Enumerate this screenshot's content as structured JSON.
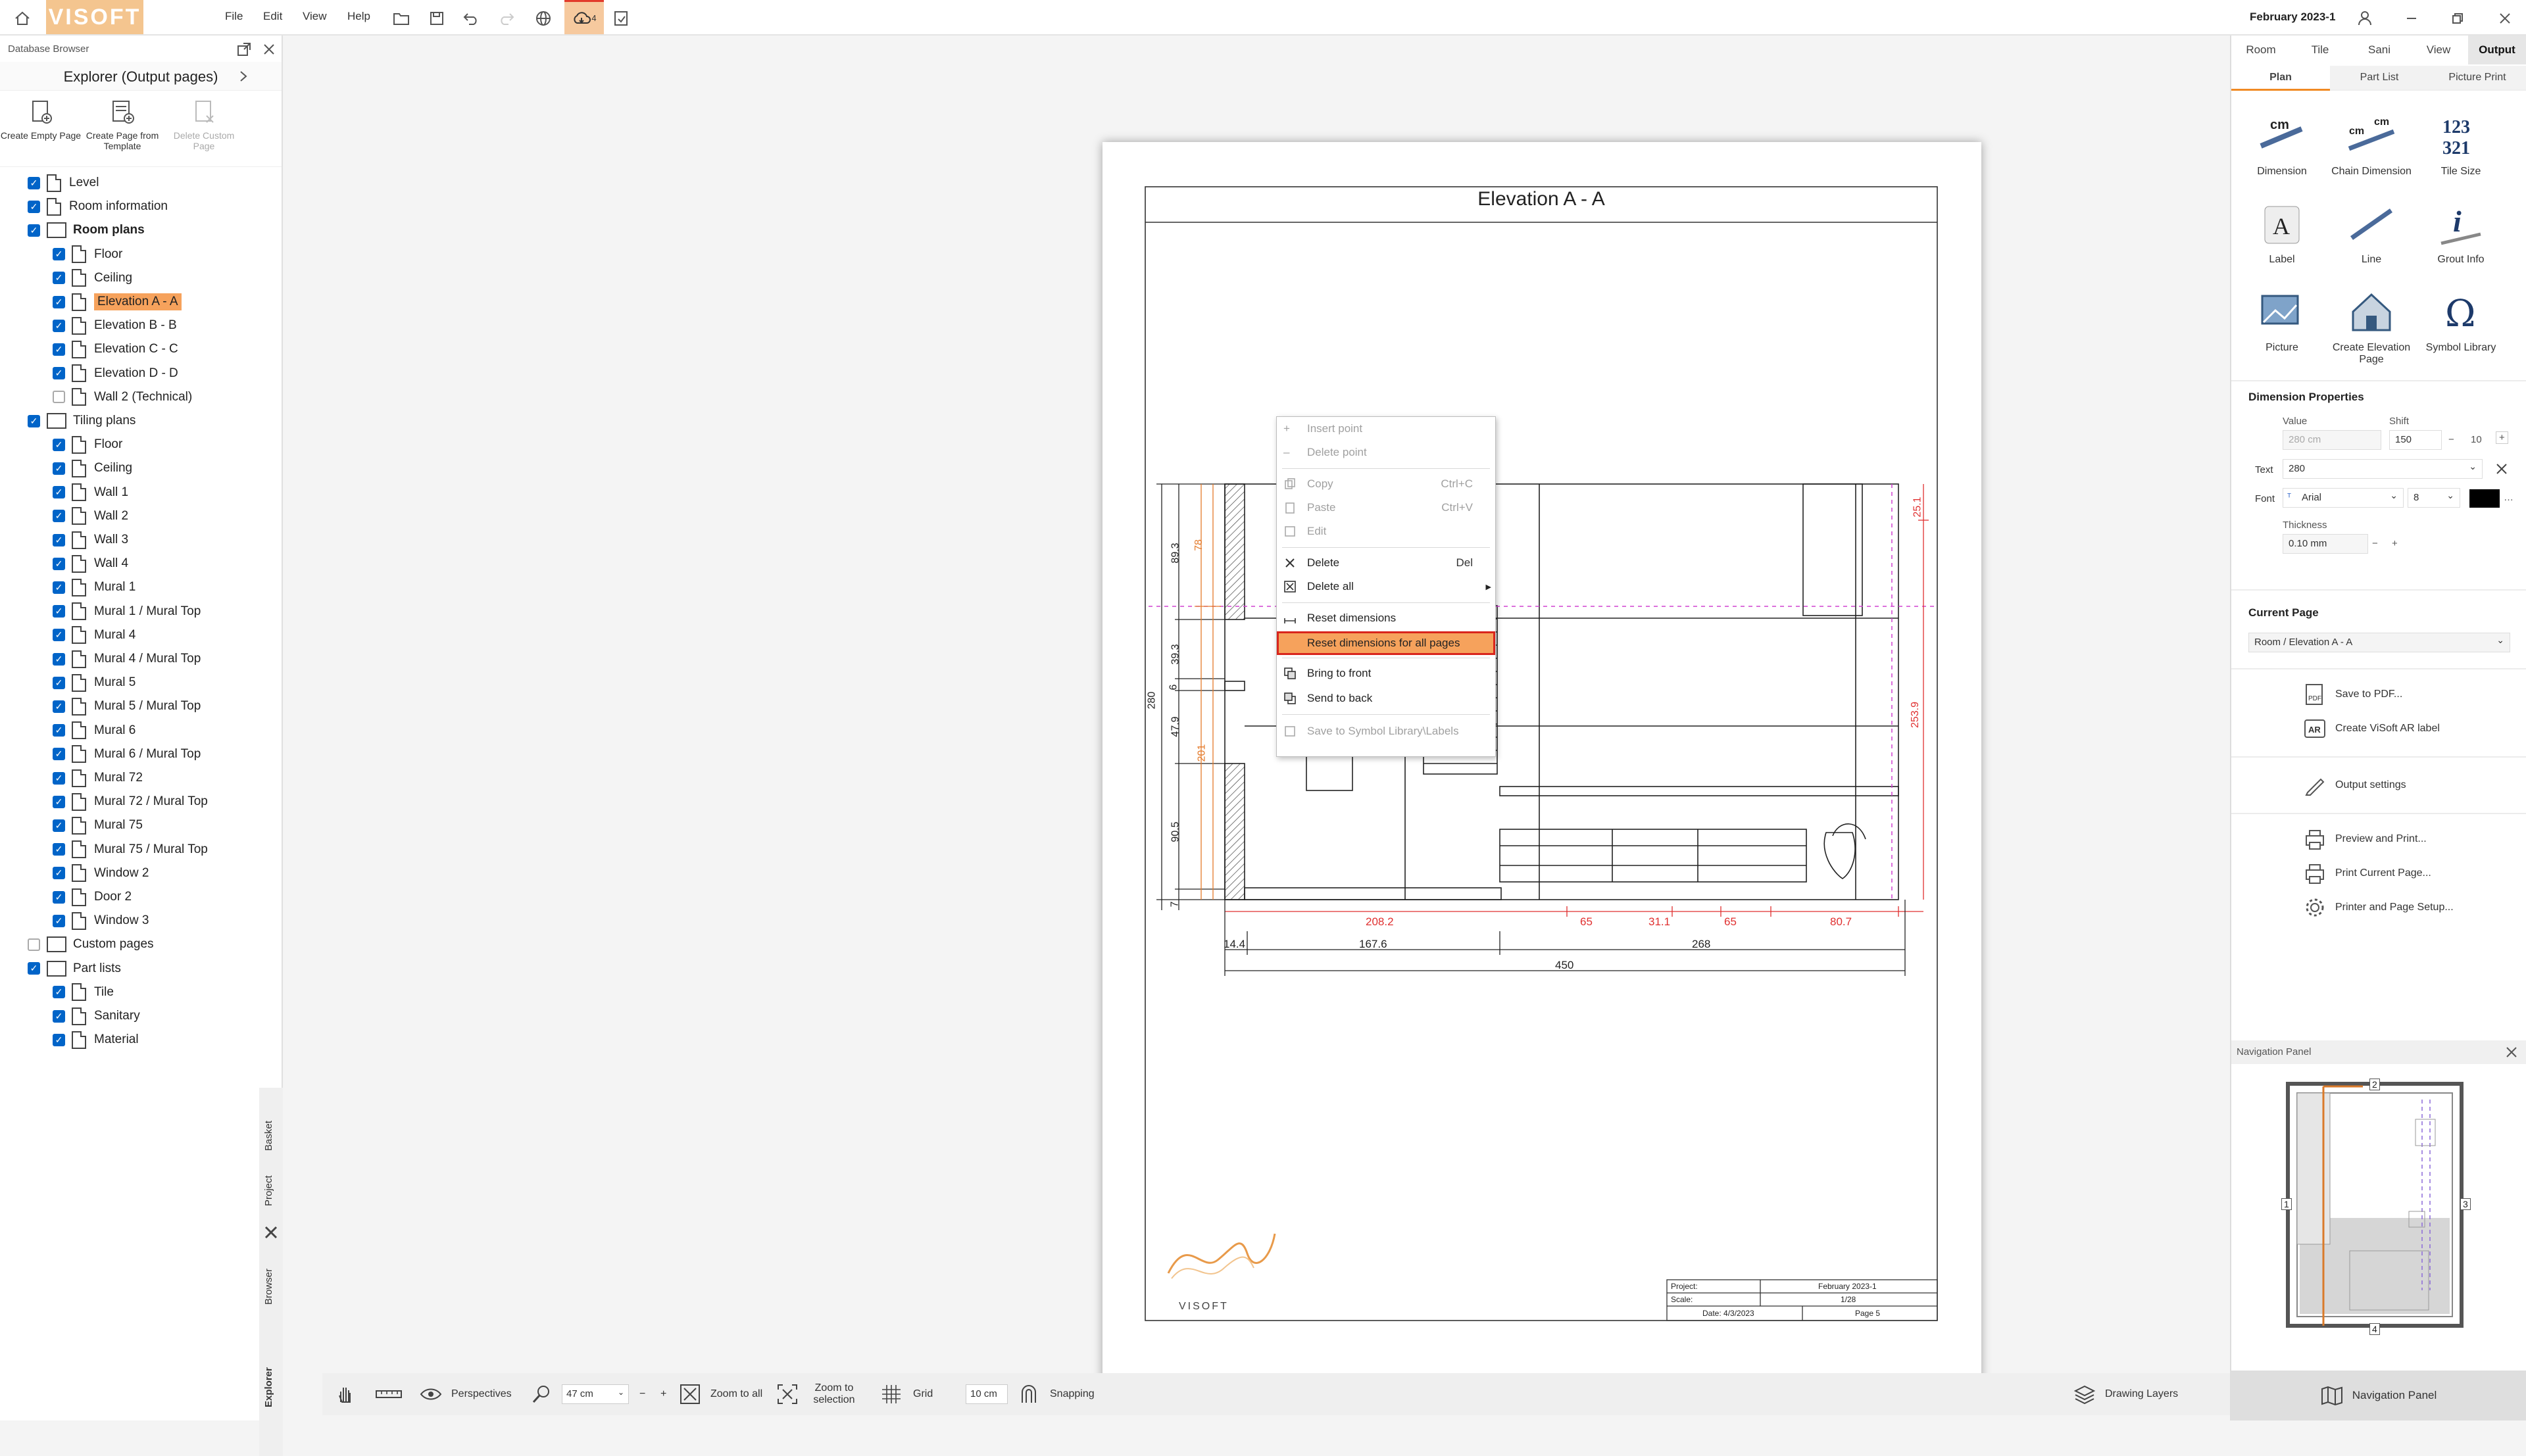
{
  "app": {
    "logo": "VISOFT",
    "menu": [
      "File",
      "Edit",
      "View",
      "Help"
    ],
    "sync_badge": "4",
    "project_name": "February 2023-1"
  },
  "left": {
    "db_title": "Database Browser",
    "explorer_title": "Explorer (Output pages)",
    "tools": {
      "create_empty": "Create Empty Page",
      "create_template": "Create Page from Template",
      "delete_custom": "Delete Custom Page"
    },
    "tree": [
      {
        "label": "Level",
        "lvl": 1,
        "type": "page",
        "checked": true
      },
      {
        "label": "Room information",
        "lvl": 1,
        "type": "page",
        "checked": true
      },
      {
        "label": "Room plans",
        "lvl": 1,
        "type": "folder",
        "checked": true,
        "bold": true
      },
      {
        "label": "Floor",
        "lvl": 2,
        "type": "page",
        "checked": true
      },
      {
        "label": "Ceiling",
        "lvl": 2,
        "type": "page",
        "checked": true
      },
      {
        "label": "Elevation A - A",
        "lvl": 2,
        "type": "page",
        "checked": true,
        "selected": true
      },
      {
        "label": "Elevation B - B",
        "lvl": 2,
        "type": "page",
        "checked": true
      },
      {
        "label": "Elevation C - C",
        "lvl": 2,
        "type": "page",
        "checked": true
      },
      {
        "label": "Elevation D - D",
        "lvl": 2,
        "type": "page",
        "checked": true
      },
      {
        "label": "Wall 2 (Technical)",
        "lvl": 2,
        "type": "page",
        "checked": false
      },
      {
        "label": "Tiling plans",
        "lvl": 1,
        "type": "folder",
        "checked": true
      },
      {
        "label": "Floor",
        "lvl": 2,
        "type": "page",
        "checked": true
      },
      {
        "label": "Ceiling",
        "lvl": 2,
        "type": "page",
        "checked": true
      },
      {
        "label": "Wall 1",
        "lvl": 2,
        "type": "page",
        "checked": true
      },
      {
        "label": "Wall 2",
        "lvl": 2,
        "type": "page",
        "checked": true
      },
      {
        "label": "Wall 3",
        "lvl": 2,
        "type": "page",
        "checked": true
      },
      {
        "label": "Wall 4",
        "lvl": 2,
        "type": "page",
        "checked": true
      },
      {
        "label": "Mural 1",
        "lvl": 2,
        "type": "page",
        "checked": true
      },
      {
        "label": "Mural 1 / Mural Top",
        "lvl": 2,
        "type": "page",
        "checked": true
      },
      {
        "label": "Mural 4",
        "lvl": 2,
        "type": "page",
        "checked": true
      },
      {
        "label": "Mural 4 / Mural Top",
        "lvl": 2,
        "type": "page",
        "checked": true
      },
      {
        "label": "Mural 5",
        "lvl": 2,
        "type": "page",
        "checked": true
      },
      {
        "label": "Mural 5 / Mural Top",
        "lvl": 2,
        "type": "page",
        "checked": true
      },
      {
        "label": "Mural 6",
        "lvl": 2,
        "type": "page",
        "checked": true
      },
      {
        "label": "Mural 6 / Mural Top",
        "lvl": 2,
        "type": "page",
        "checked": true
      },
      {
        "label": "Mural 72",
        "lvl": 2,
        "type": "page",
        "checked": true
      },
      {
        "label": "Mural 72 / Mural Top",
        "lvl": 2,
        "type": "page",
        "checked": true
      },
      {
        "label": "Mural 75",
        "lvl": 2,
        "type": "page",
        "checked": true
      },
      {
        "label": "Mural 75 / Mural Top",
        "lvl": 2,
        "type": "page",
        "checked": true
      },
      {
        "label": "Window 2",
        "lvl": 2,
        "type": "page",
        "checked": true
      },
      {
        "label": "Door 2",
        "lvl": 2,
        "type": "page",
        "checked": true
      },
      {
        "label": "Window 3",
        "lvl": 2,
        "type": "page",
        "checked": true
      },
      {
        "label": "Custom pages",
        "lvl": 1,
        "type": "folder",
        "checked": false
      },
      {
        "label": "Part lists",
        "lvl": 1,
        "type": "folder",
        "checked": true
      },
      {
        "label": "Tile",
        "lvl": 2,
        "type": "page",
        "checked": true
      },
      {
        "label": "Sanitary",
        "lvl": 2,
        "type": "page",
        "checked": true
      },
      {
        "label": "Material",
        "lvl": 2,
        "type": "page",
        "checked": true
      }
    ],
    "side_tabs": [
      "Basket",
      "Project",
      "Browser",
      "Explorer"
    ]
  },
  "drawing": {
    "title": "Elevation A - A",
    "dims": {
      "left_outer": "280",
      "left_segments": [
        "89.3",
        "39.3",
        "6",
        "47.9",
        "90.5",
        "7"
      ],
      "left_orange": [
        "78",
        "201"
      ],
      "right_segments": [
        "25.1",
        "253.9"
      ],
      "red_row": [
        "208.2",
        "65",
        "31.1",
        "65",
        "80.7"
      ],
      "row2": [
        "14.4",
        "167.6",
        "268"
      ],
      "row3": "450"
    },
    "footer": {
      "project_label": "Project:",
      "project_value": "February 2023-1",
      "scale_label": "Scale:",
      "scale_value": "1/28",
      "date": "Date: 4/3/2023",
      "page": "Page 5",
      "brand": "VISOFT"
    }
  },
  "context_menu": {
    "insert_point": "Insert point",
    "delete_point": "Delete point",
    "copy": "Copy",
    "copy_sc": "Ctrl+C",
    "paste": "Paste",
    "paste_sc": "Ctrl+V",
    "edit": "Edit",
    "delete": "Delete",
    "delete_sc": "Del",
    "delete_all": "Delete all",
    "reset_dims": "Reset dimensions",
    "reset_dims_all": "Reset dimensions for all pages",
    "bring_front": "Bring to front",
    "send_back": "Send to back",
    "save_symbol": "Save to Symbol Library\\Labels"
  },
  "bottom": {
    "perspectives": "Perspectives",
    "zoom": "47 cm",
    "zoom_all": "Zoom to all",
    "zoom_sel": "Zoom to selection",
    "grid": "Grid",
    "grid_val": "10 cm",
    "snapping": "Snapping",
    "layers": "Drawing Layers"
  },
  "right": {
    "tabs": [
      "Room",
      "Tile",
      "Sani",
      "View",
      "Output"
    ],
    "active_tab": "Output",
    "subtabs": [
      "Plan",
      "Part List",
      "Picture Print"
    ],
    "tools": [
      "Dimension",
      "Chain Dimension",
      "Tile Size",
      "Label",
      "Line",
      "Grout Info",
      "Picture",
      "Create Elevation Page",
      "Symbol Library"
    ],
    "dim_props_title": "Dimension Properties",
    "value_label": "Value",
    "value_placeholder": "280 cm",
    "shift_label": "Shift",
    "shift_value": "150",
    "shift_step": "10",
    "text_label": "Text",
    "text_value": "280",
    "font_label": "Font",
    "font_value": "Arial",
    "font_size": "8",
    "thickness_label": "Thickness",
    "thickness_value": "0.10 mm",
    "current_page_title": "Current Page",
    "current_page_value": "Room / Elevation A - A",
    "actions": [
      "Save to PDF...",
      "Create ViSoft AR label",
      "Output settings",
      "Preview and Print...",
      "Print Current Page...",
      "Printer and Page Setup..."
    ],
    "nav_title": "Navigation Panel",
    "nav_footer": "Navigation Panel",
    "nav_markers": [
      "1",
      "2",
      "3",
      "4"
    ]
  }
}
